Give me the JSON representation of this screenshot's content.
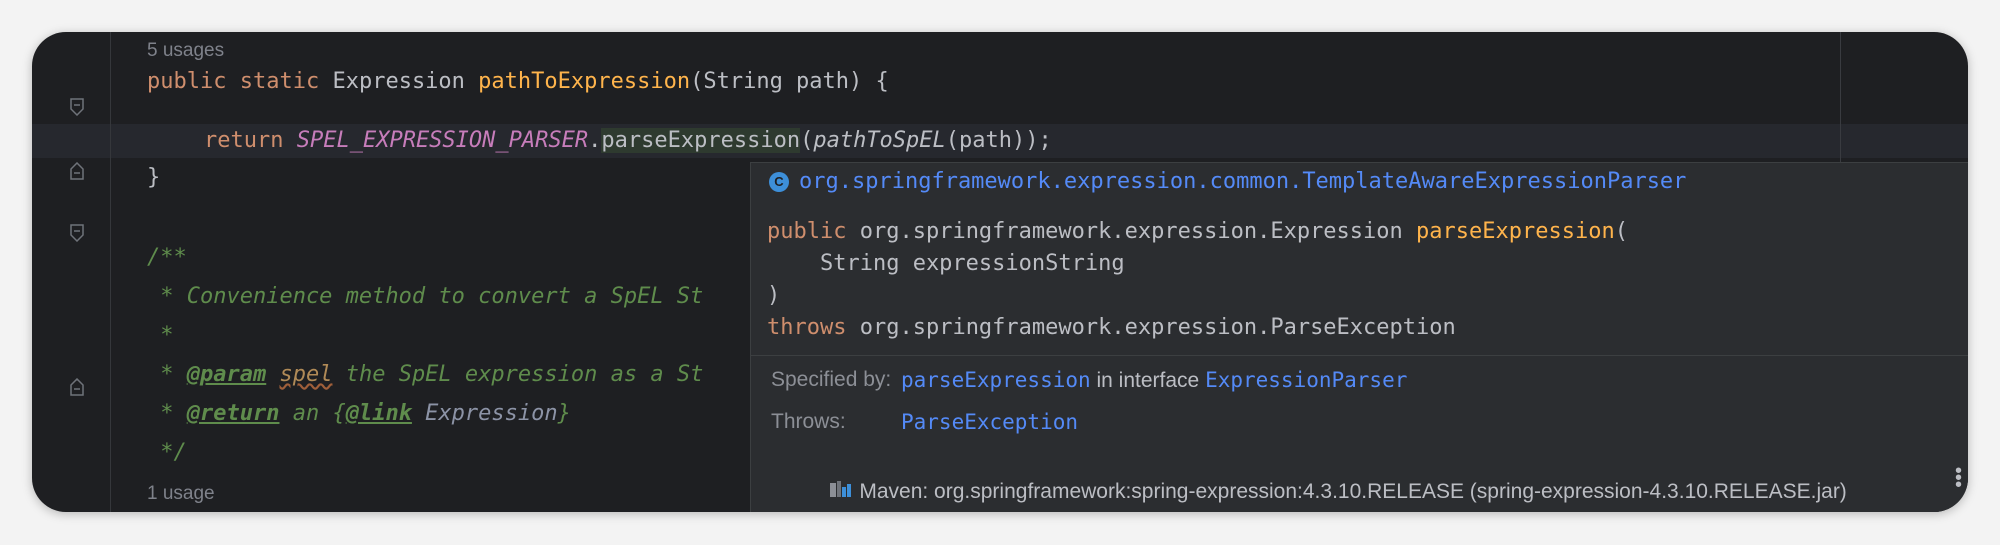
{
  "editor": {
    "hint_top": "5 usages",
    "line1": {
      "kw1": "public",
      "kw2": "static",
      "type": "Expression",
      "method": "pathToExpression",
      "params": "(String path) {"
    },
    "line2": {
      "kw": "return",
      "const": "SPEL_EXPRESSION_PARSER",
      "dot": ".",
      "call": "parseExpression",
      "open": "(",
      "inner": "pathToSpEL",
      "rest": "(path));"
    },
    "line3": "}",
    "doc": {
      "open": "/**",
      "desc": " * Convenience method to convert a SpEL St",
      "blank": " *",
      "param_prefix": " * ",
      "param_tag": "@param",
      "param_name": "spel",
      "param_desc": " the SpEL expression as a St",
      "return_prefix": " * ",
      "return_tag": "@return",
      "return_mid": " an {",
      "link_tag": "@link",
      "link_target": " Expression",
      "link_close": "}",
      "close": " */"
    },
    "hint_bottom": "1 usage"
  },
  "popup": {
    "class_icon": "C",
    "class_name": "org.springframework.expression.common.TemplateAwareExpressionParser",
    "sig_kw": "public",
    "sig_return": " org.springframework.expression.Expression ",
    "sig_method": "parseExpression",
    "sig_open": "(",
    "sig_param": "    String expressionString",
    "sig_close": ")",
    "throws_kw": "throws",
    "throws_type": " org.springframework.expression.ParseException",
    "specified_label": "Specified by:",
    "specified_method": "parseExpression",
    "specified_mid": " in interface ",
    "specified_iface": "ExpressionParser",
    "throws_label": "Throws:",
    "throws_link": "ParseException",
    "maven": "Maven: org.springframework:spring-expression:4.3.10.RELEASE (spring-expression-4.3.10.RELEASE.jar)"
  },
  "colors": {
    "editor_bg": "#1e1f22",
    "popup_bg": "#2b2d30",
    "keyword": "#cf8e6d",
    "link": "#548af7",
    "method_decl": "#ffb44c",
    "comment": "#5f8c4c"
  }
}
